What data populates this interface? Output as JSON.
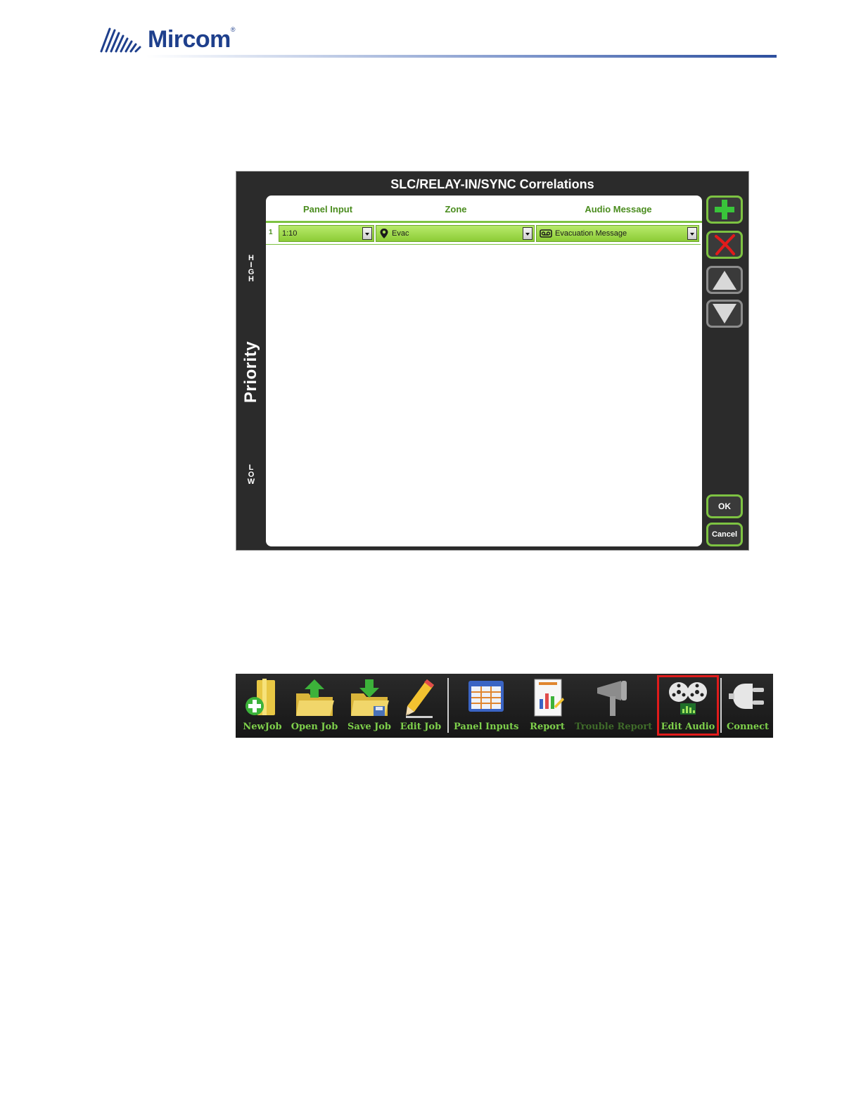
{
  "header": {
    "brand": "Mircom",
    "trademark": "®"
  },
  "dialog": {
    "title": "SLC/RELAY-IN/SYNC Correlations",
    "priority": {
      "label": "Priority",
      "high": "H\nI\nG\nH",
      "low": "L\nO\nW"
    },
    "columns": [
      "Panel Input",
      "Zone",
      "Audio Message"
    ],
    "rows": [
      {
        "num": "1",
        "panel_input": "1:10",
        "zone": "Evac",
        "audio_message": "Evacuation Message"
      }
    ],
    "buttons": {
      "ok": "OK",
      "cancel": "Cancel"
    },
    "colors": {
      "accent": "#7dc242",
      "background": "#2b2b2b"
    }
  },
  "toolbar": {
    "items": [
      {
        "label": "NewJob"
      },
      {
        "label": "Open Job"
      },
      {
        "label": "Save Job"
      },
      {
        "label": "Edit Job"
      },
      {
        "label": "Panel Inputs"
      },
      {
        "label": "Report"
      },
      {
        "label": "Trouble Report"
      },
      {
        "label": "Edit Audio"
      },
      {
        "label": "Connect"
      }
    ],
    "highlight_color": "#e01b1b"
  }
}
